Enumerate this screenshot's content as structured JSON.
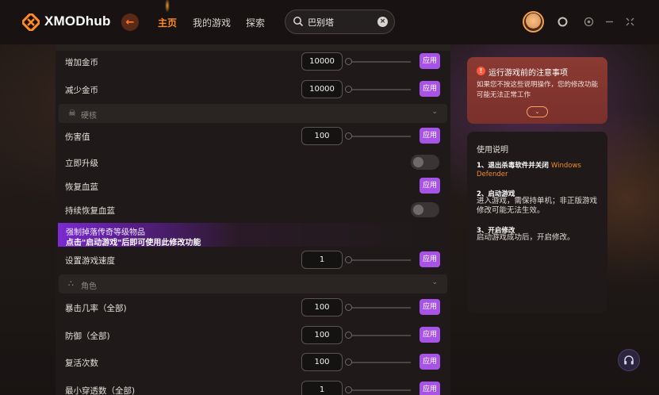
{
  "app": {
    "brand": "XMODhub"
  },
  "nav": {
    "home": "主页",
    "my_games": "我的游戏",
    "explore": "探索"
  },
  "search": {
    "value": "巴别塔",
    "placeholder": ""
  },
  "main": {
    "rows": [
      {
        "label": "增加金币",
        "value": "10000",
        "apply": "应用"
      },
      {
        "label": "减少金币",
        "value": "10000",
        "apply": "应用"
      },
      {
        "label": "伤害值",
        "value": "100",
        "apply": "应用"
      },
      {
        "label": "立即升级"
      },
      {
        "label": "恢复血蓝",
        "apply": "应用"
      },
      {
        "label": "持续恢复血蓝"
      },
      {
        "label": "设置游戏速度",
        "value": "1",
        "apply": "应用"
      },
      {
        "label": "暴击几率（全部)",
        "value": "100",
        "apply": "应用"
      },
      {
        "label": "防御（全部)",
        "value": "100",
        "apply": "应用"
      },
      {
        "label": "复活次数",
        "value": "100",
        "apply": "应用"
      },
      {
        "label": "最小穿透数（全部)",
        "value": "1",
        "apply": "应用"
      }
    ],
    "sections": [
      {
        "title": "硬核"
      },
      {
        "title": "角色"
      }
    ],
    "promo": {
      "line1": "强制掉落传奇等级物品",
      "line2": "点击\"启动游戏\"后即可使用此修改功能"
    }
  },
  "notice": {
    "title": "运行游戏前的注意事项",
    "text": "如果您不按这些说明操作，您的修改功能可能无法正常工作"
  },
  "guide": {
    "title": "使用说明",
    "step1_head": "1、退出杀毒软件并关闭",
    "step1_highlight": "Windows Defender",
    "step2_head": "2、启动游戏",
    "step2_body": "进入游戏，需保持单机；非正版游戏修改可能无法生效。",
    "step3_head": "3、开启修改",
    "step3_body": "启动游戏成功后，开启修改。"
  },
  "icons": {
    "logo": "xmod-logo-icon",
    "back": "back-arrow-icon",
    "search": "search-icon",
    "clear": "clear-icon",
    "hardcore": "skull-icon",
    "character": "character-icon",
    "warning": "warning-icon",
    "expand": "chevron-down-icon",
    "support": "headset-icon"
  },
  "colors": {
    "accent": "#ff8a2a",
    "apply_button": "#a653e6",
    "notice_bg": "#8a3a32"
  }
}
